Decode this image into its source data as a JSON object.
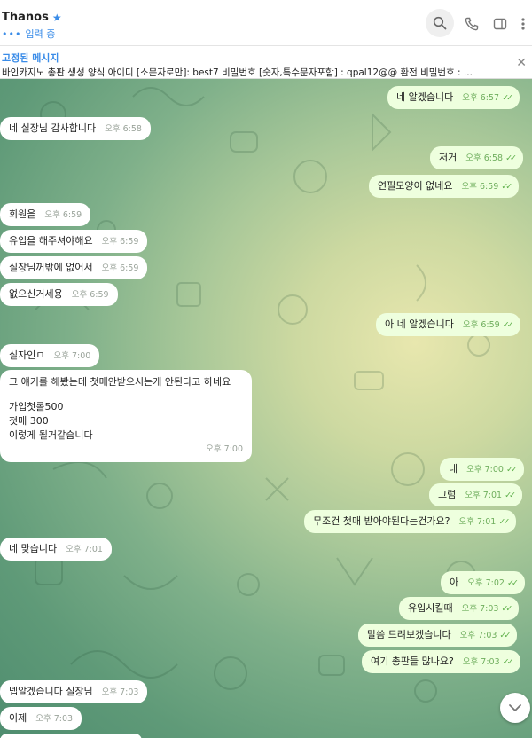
{
  "header": {
    "title": "Thanos",
    "status": "입력 중"
  },
  "pinned": {
    "label": "고정된 메시지",
    "text": "바인카지노 총판 생성 양식  아이디 [소문자로만]: best7  비밀번호 [숫자,특수문자포함] : qpal12@@ 환전 비밀번호 : ..."
  },
  "messages": [
    {
      "text": "네 알겠습니다",
      "time": "오후 6:57",
      "out": true
    },
    {
      "text": "네 실장님 감사합니다",
      "time": "오후 6:58",
      "out": false
    },
    {
      "text": "저거",
      "time": "오후 6:58",
      "out": true
    },
    {
      "text": "연필모양이 없네요",
      "time": "오후 6:59",
      "out": true
    },
    {
      "text": "회원을",
      "time": "오후 6:59",
      "out": false
    },
    {
      "text": "유입을 해주셔야해요",
      "time": "오후 6:59",
      "out": false
    },
    {
      "text": "실장님꺼밖에 없어서",
      "time": "오후 6:59",
      "out": false
    },
    {
      "text": "없으신거세용",
      "time": "오후 6:59",
      "out": false
    },
    {
      "text": "아 네 알겠습니다",
      "time": "오후 6:59",
      "out": true
    },
    {
      "text": "실자인ㅁ",
      "time": "오후 7:00",
      "out": false
    },
    {
      "lines": [
        "그 얘기를 해봤는데 첫매안받으시는게 안된다고 하네요",
        "",
        "가입첫롤500",
        "첫매 300",
        "이렇게 될거같습니다"
      ],
      "time": "오후 7:00",
      "out": false
    },
    {
      "text": "네",
      "time": "오후 7:00",
      "out": true
    },
    {
      "text": "그럼",
      "time": "오후 7:01",
      "out": true
    },
    {
      "text": "무조건 첫매 받아야된다는건가요?",
      "time": "오후 7:01",
      "out": true
    },
    {
      "text": "네 맞습니다",
      "time": "오후 7:01",
      "out": false
    },
    {
      "text": "아",
      "time": "오후 7:02",
      "out": true
    },
    {
      "text": "유입시킬때",
      "time": "오후 7:03",
      "out": true
    },
    {
      "text": "말씀 드려보겠습니다",
      "time": "오후 7:03",
      "out": true
    },
    {
      "text": "여기 총판들 많나요?",
      "time": "오후 7:03",
      "out": true
    },
    {
      "text": "넵알겠습니다 실장님",
      "time": "오후 7:03",
      "out": false
    },
    {
      "text": "이제",
      "time": "오후 7:03",
      "out": false
    }
  ],
  "icons": {
    "search": "search-icon",
    "phone": "phone-icon",
    "panel": "sidebar-toggle-icon",
    "more": "more-vertical-icon",
    "star": "star-icon",
    "scroll": "chevron-down-icon"
  },
  "colors": {
    "accent": "#3a8ce8",
    "outgoing_bubble": "#eeffde",
    "incoming_bubble": "#ffffff",
    "read_check": "#5fb04b"
  }
}
